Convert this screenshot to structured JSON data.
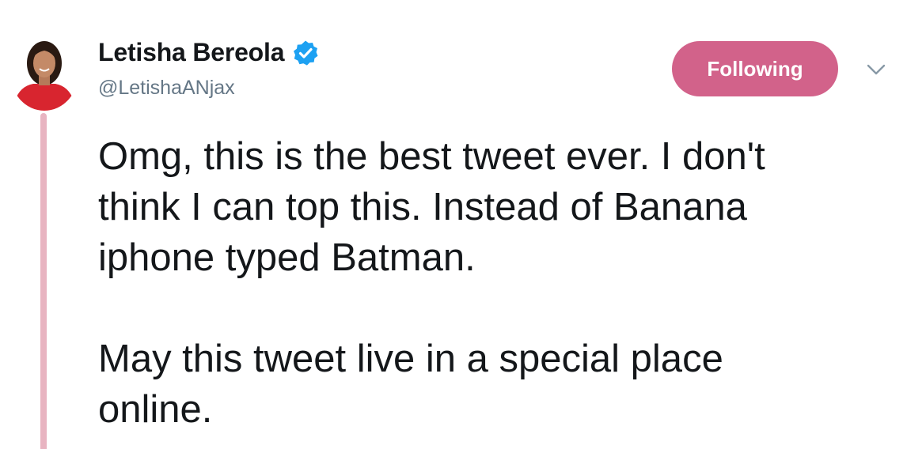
{
  "author": {
    "display_name": "Letisha Bereola",
    "handle": "@LetishaANjax",
    "verified": true,
    "avatar_icon": "profile-photo"
  },
  "follow_button": {
    "label": "Following",
    "color": "#d2628a"
  },
  "menu": {
    "icon": "chevron-down-icon"
  },
  "tweet": {
    "paragraphs": [
      {
        "lines": [
          "Omg, this is the best tweet ever. I don't",
          "think I can top this. Instead of Banana",
          "iphone typed Batman."
        ]
      },
      {
        "lines": [
          "May this tweet live in a special place",
          "online."
        ]
      }
    ]
  },
  "colors": {
    "verified_badge": "#1da1f2",
    "thread_line": "#e8b4c1",
    "handle_text": "#657786"
  }
}
